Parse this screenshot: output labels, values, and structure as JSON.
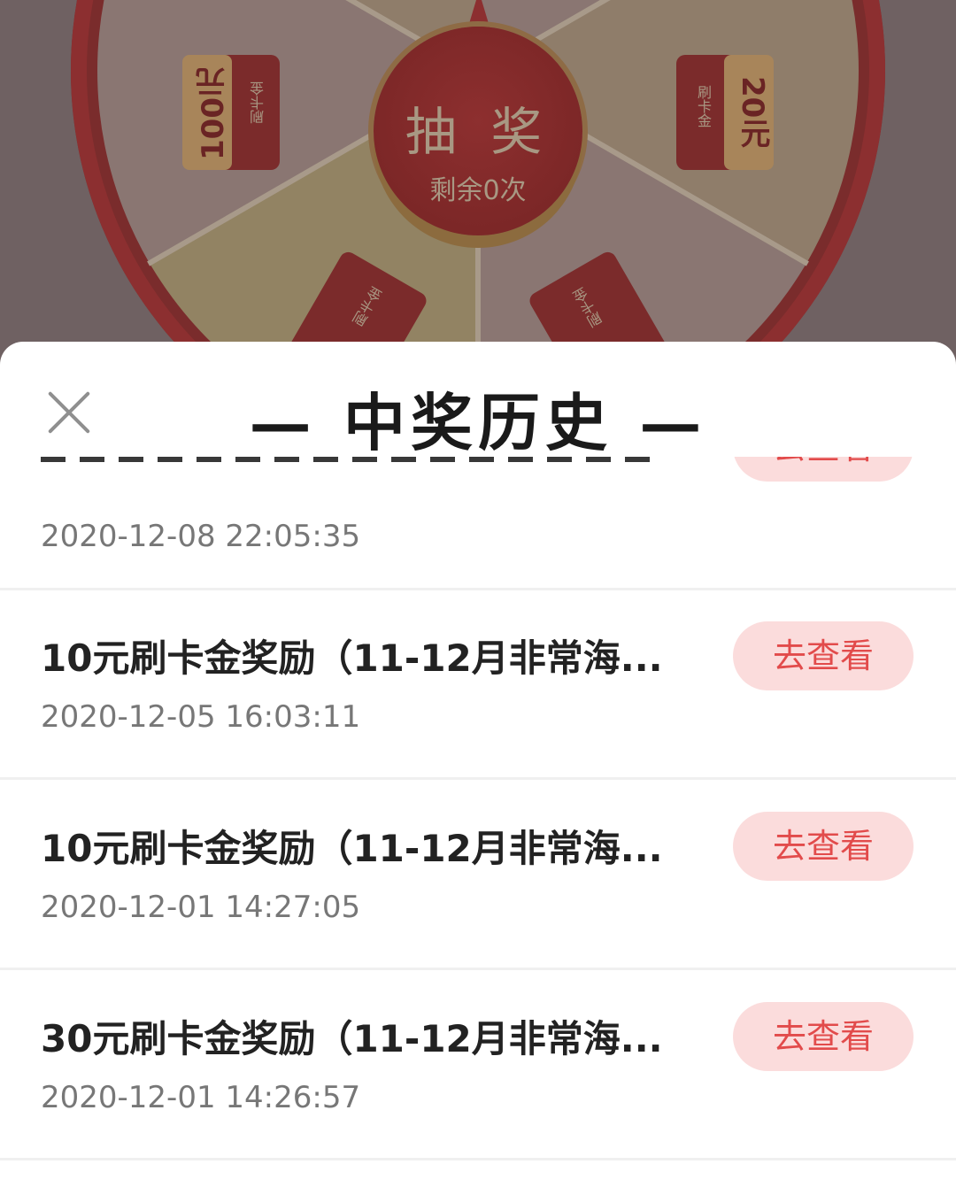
{
  "wheel": {
    "center_title": "抽 奖",
    "center_sub": "剩余0次",
    "prizes": [
      {
        "amount": "100元",
        "label": "刷卡金"
      },
      {
        "amount": "20元",
        "label": "刷卡金"
      },
      {
        "amount": "",
        "label": "刷卡金"
      },
      {
        "amount": "",
        "label": "刷卡金"
      }
    ]
  },
  "sheet": {
    "title": "— 中奖历史 —",
    "rows": [
      {
        "title": "",
        "date": "2020-12-08 22:05:35",
        "button": "去查看"
      },
      {
        "title": "10元刷卡金奖励（11-12月非常海...",
        "date": "2020-12-05 16:03:11",
        "button": "去查看"
      },
      {
        "title": "10元刷卡金奖励（11-12月非常海...",
        "date": "2020-12-01 14:27:05",
        "button": "去查看"
      },
      {
        "title": "30元刷卡金奖励（11-12月非常海...",
        "date": "2020-12-01 14:26:57",
        "button": "去查看"
      }
    ]
  }
}
